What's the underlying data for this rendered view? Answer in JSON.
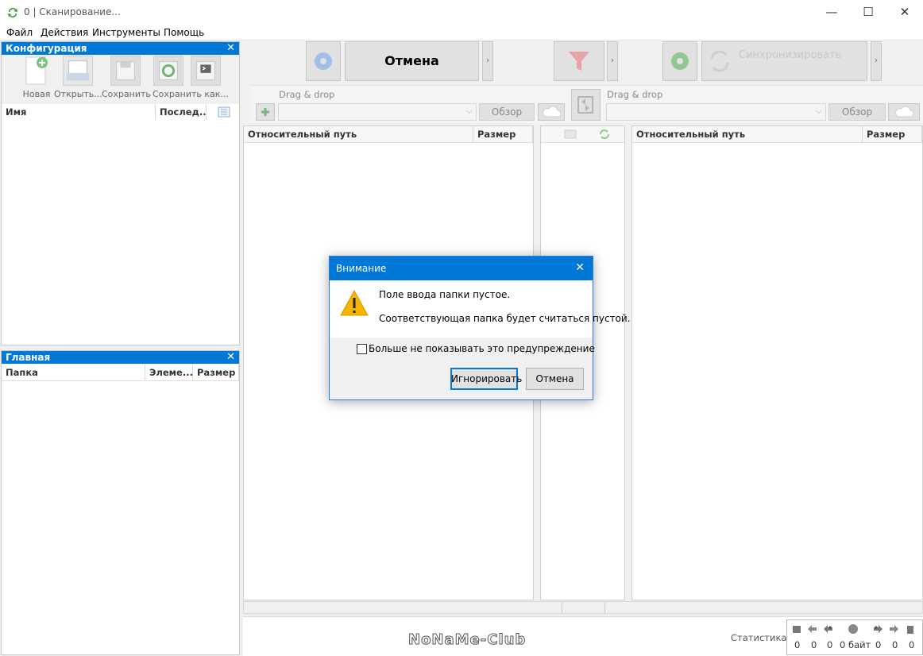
{
  "window": {
    "title": "0 | Сканирование...",
    "minimize": "—",
    "maximize": "☐",
    "close": "✕"
  },
  "menu": [
    "Файл",
    "Действия",
    "Инструменты",
    "Помощь"
  ],
  "config_panel": {
    "title": "Конфигурация",
    "close": "✕",
    "buttons": [
      "Новая",
      "Открыть...",
      "Сохранить",
      "Сохранить как..."
    ],
    "columns": [
      "Имя",
      "Послед..."
    ]
  },
  "main_panel": {
    "title": "Главная",
    "close": "✕",
    "columns": [
      "Папка",
      "Элеме...",
      "Размер"
    ]
  },
  "toolbar": {
    "cancel_label": "Отмена",
    "sync_label": "Синхронизировать"
  },
  "left_folder": {
    "drag_label": "Drag & drop",
    "browse_label": "Обзор"
  },
  "right_folder": {
    "drag_label": "Drag & drop",
    "browse_label": "Обзор"
  },
  "left_grid": {
    "columns": [
      "Относительный путь",
      "Размер"
    ]
  },
  "right_grid": {
    "columns": [
      "Относительный путь",
      "Размер"
    ]
  },
  "status": {
    "label": "Статистика:",
    "values": [
      "0",
      "0",
      "0",
      "0 байт",
      "0",
      "0",
      "0"
    ]
  },
  "watermark": "NoNaMe-Club",
  "dialog": {
    "title": "Внимание",
    "close": "✕",
    "message1": "Поле ввода папки пустое.",
    "message2": "Соответствующая папка будет считаться пустой.",
    "checkbox_label": "Больше не показывать это предупреждение",
    "ignore_label": "Игнорировать",
    "cancel_label": "Отмена"
  },
  "colors": {
    "accent": "#0078d7",
    "warning": "#f5b400"
  }
}
